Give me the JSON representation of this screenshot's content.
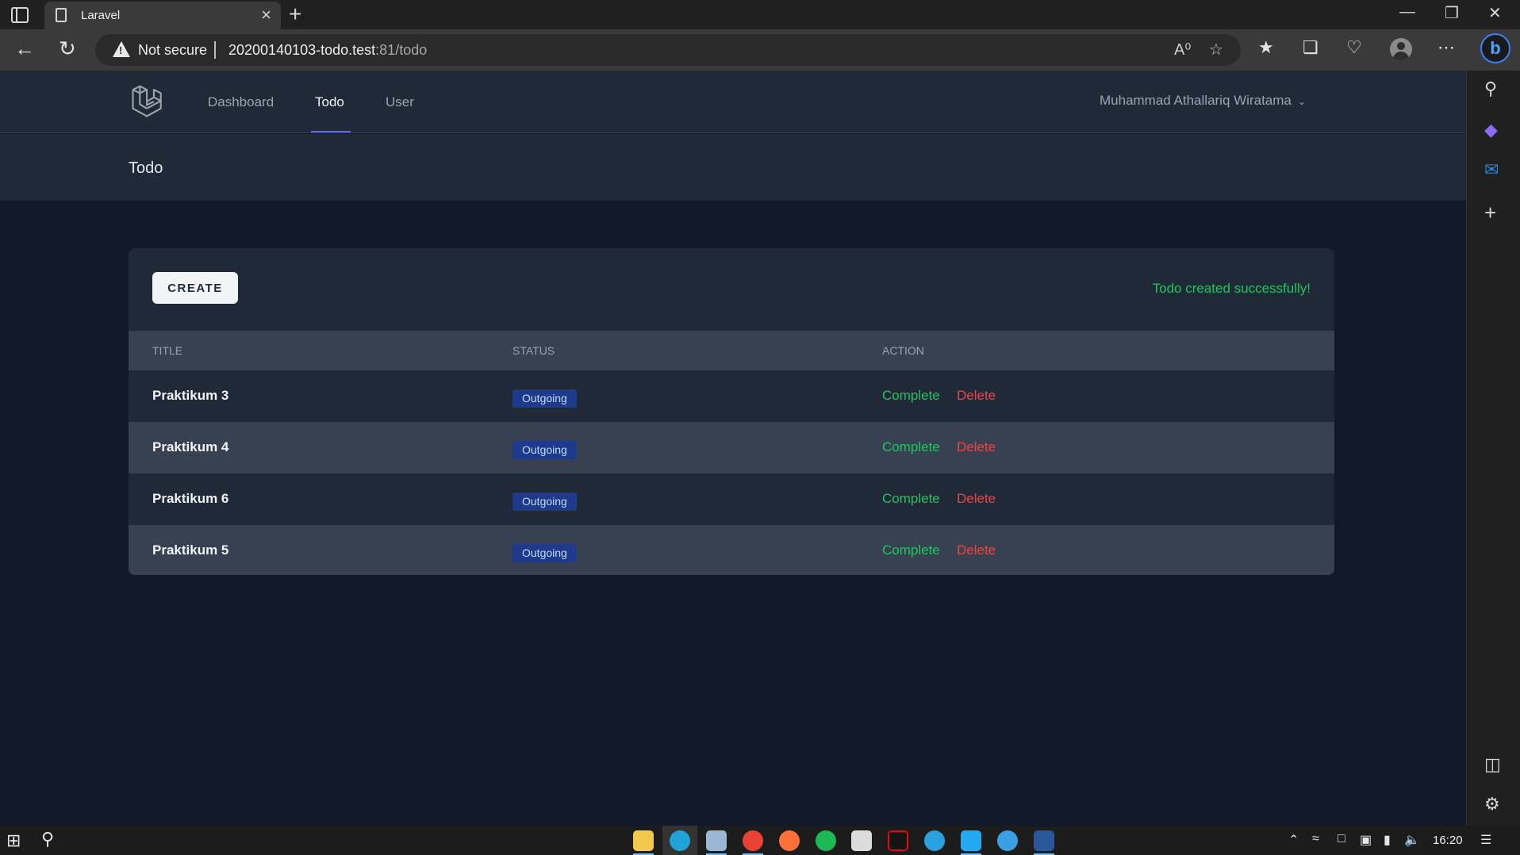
{
  "browser": {
    "tab_title": "Laravel",
    "tab_close": "×",
    "new_tab": "+",
    "not_secure": "Not secure",
    "url_host": "20200140103-todo.test",
    "url_path": ":81/todo"
  },
  "nav": {
    "links": [
      "Dashboard",
      "Todo",
      "User"
    ],
    "active": "Todo",
    "user_name": "Muhammad Athallariq Wiratama"
  },
  "header": {
    "title": "Todo"
  },
  "card": {
    "create_label": "CREATE",
    "flash_message": "Todo created successfully!",
    "columns": [
      "TITLE",
      "STATUS",
      "ACTION"
    ],
    "rows": [
      {
        "title": "Praktikum 3",
        "status": "Outgoing",
        "complete": "Complete",
        "delete": "Delete"
      },
      {
        "title": "Praktikum 4",
        "status": "Outgoing",
        "complete": "Complete",
        "delete": "Delete"
      },
      {
        "title": "Praktikum 6",
        "status": "Outgoing",
        "complete": "Complete",
        "delete": "Delete"
      },
      {
        "title": "Praktikum 5",
        "status": "Outgoing",
        "complete": "Complete",
        "delete": "Delete"
      }
    ]
  },
  "taskbar": {
    "time": "16:20"
  },
  "colors": {
    "accent": "#6366f1",
    "success": "#22c55e",
    "danger": "#ef4444",
    "badge_bg": "#1e3a8a"
  }
}
